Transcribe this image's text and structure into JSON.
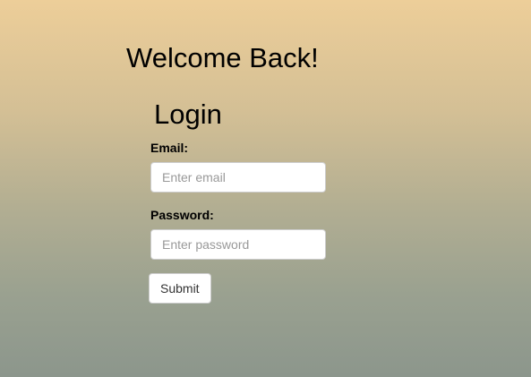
{
  "header": {
    "welcome_text": "Welcome Back!"
  },
  "login_form": {
    "title": "Login",
    "email": {
      "label": "Email:",
      "value": "",
      "placeholder": "Enter email"
    },
    "password": {
      "label": "Password:",
      "value": "",
      "placeholder": "Enter password"
    },
    "submit_label": "Submit"
  }
}
